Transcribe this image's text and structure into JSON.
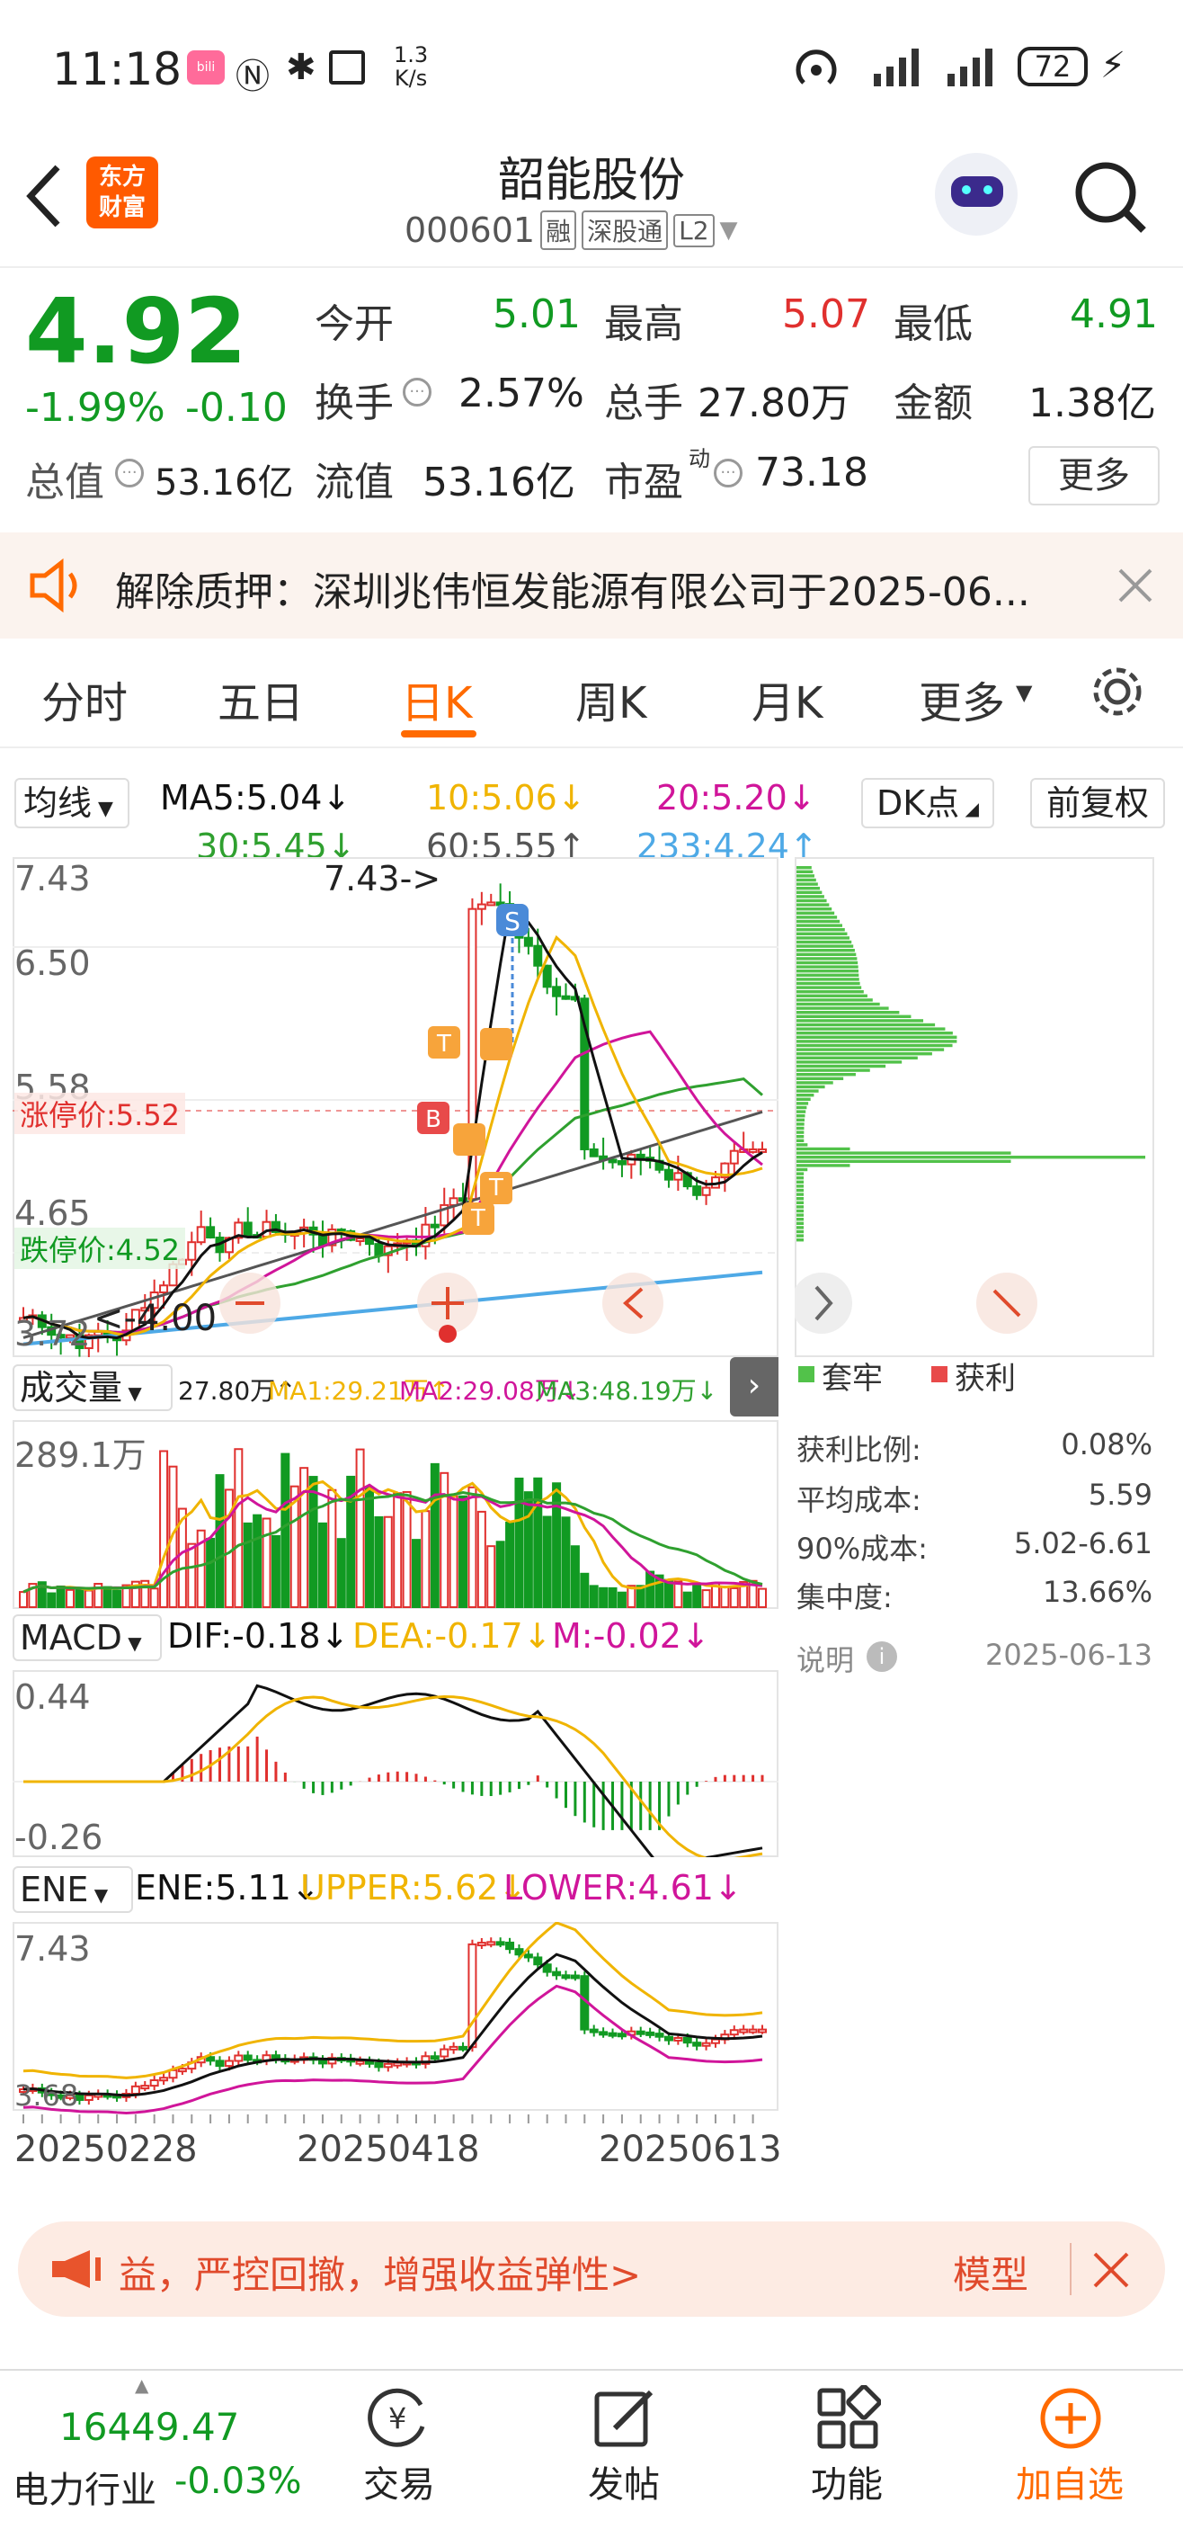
{
  "status": {
    "time": "11:18",
    "speed_top": "1.3",
    "speed_unit": "K/s",
    "battery": "72",
    "app_badge": "bili"
  },
  "header": {
    "back_icon": "back-arrow-icon",
    "logo_line1": "东方",
    "logo_line2": "财富",
    "title": "韶能股份",
    "code": "000601",
    "tags": [
      "融",
      "深股通",
      "L2"
    ]
  },
  "quote": {
    "price": "4.92",
    "change_pct": "-1.99%",
    "change": "-0.10",
    "rows": [
      [
        {
          "label": "今开",
          "value": "5.01",
          "color": "#119a22"
        },
        {
          "label": "最高",
          "value": "5.07",
          "color": "#e0302e"
        },
        {
          "label": "最低",
          "value": "4.91",
          "color": "#119a22"
        }
      ],
      [
        {
          "label": "换手",
          "value": "2.57%",
          "color": "#222"
        },
        {
          "label": "总手",
          "value": "27.80万",
          "color": "#222"
        },
        {
          "label": "金额",
          "value": "1.38亿",
          "color": "#222"
        }
      ]
    ],
    "cap_label": "总值",
    "cap_value": "53.16亿",
    "float_label": "流值",
    "float_value": "53.16亿",
    "pe_label": "市盈",
    "pe_sup": "动",
    "pe_value": "73.18",
    "more": "更多"
  },
  "notice": {
    "text": "解除质押：深圳兆伟恒发能源有限公司于2025-06..."
  },
  "tabs": {
    "items": [
      "分时",
      "五日",
      "日K",
      "周K",
      "月K",
      "更多"
    ],
    "active": "日K"
  },
  "ma": {
    "selector": "均线",
    "ma5": "MA5:5.04↓",
    "ma10": "10:5.06↓",
    "ma20": "20:5.20↓",
    "ma30": "30:5.45↓",
    "ma60": "60:5.55↑",
    "ma233": "233:4.24↑",
    "dk": "DK点",
    "fuquan": "前复权"
  },
  "kline": {
    "y_labels": [
      "7.43",
      "6.50",
      "5.58",
      "4.65",
      "3.72"
    ],
    "high_note": "7.43->",
    "low_note": "<-4.00",
    "limit_up": "涨停价:5.52",
    "limit_down": "跌停价:4.52",
    "s_marker": "S",
    "b_marker": "B",
    "t_marker": "T"
  },
  "chip": {
    "legend_trapped": "套牢",
    "legend_profit": "获利",
    "rows": [
      {
        "label": "获利比例:",
        "value": "0.08%"
      },
      {
        "label": "平均成本:",
        "value": "5.59"
      },
      {
        "label": "90%成本:",
        "value": "5.02-6.61"
      },
      {
        "label": "集中度:",
        "value": "13.66%"
      }
    ],
    "note": "说明",
    "date": "2025-06-13"
  },
  "volume": {
    "selector": "成交量",
    "v": "27.80万↑",
    "ma1": "MA1:29.21万↑",
    "ma2": "MA2:29.08万↓",
    "ma3": "MA3:48.19万↓",
    "max": "289.1万"
  },
  "macd": {
    "selector": "MACD",
    "dif": "DIF:-0.18↓",
    "dea": "DEA:-0.17↓",
    "m": "M:-0.02↓",
    "top": "0.44",
    "bottom": "-0.26"
  },
  "ene": {
    "selector": "ENE",
    "ene": "ENE:5.11↓",
    "upper": "UPPER:5.62↓",
    "lower": "LOWER:4.61↓",
    "top": "7.43",
    "bottom": "3.68"
  },
  "dates": [
    "20250228",
    "20250418",
    "20250613"
  ],
  "promo": {
    "text": "益，严控回撤，增强收益弹性>",
    "right": "模型",
    "close_icon": "close-icon"
  },
  "bottom": {
    "index_value": "16449.47",
    "index_name": "电力行业",
    "index_change": "-0.03%",
    "items": [
      "交易",
      "发帖",
      "功能",
      "加自选"
    ]
  },
  "colors": {
    "up": "#e0302e",
    "down": "#119a22",
    "accent": "#ff6a00",
    "ma5": "#111111",
    "ma10": "#f0b400",
    "ma20": "#d0159a",
    "ma30": "#2fa02f",
    "ma60": "#555555",
    "ma233": "#4ea9e6"
  }
}
